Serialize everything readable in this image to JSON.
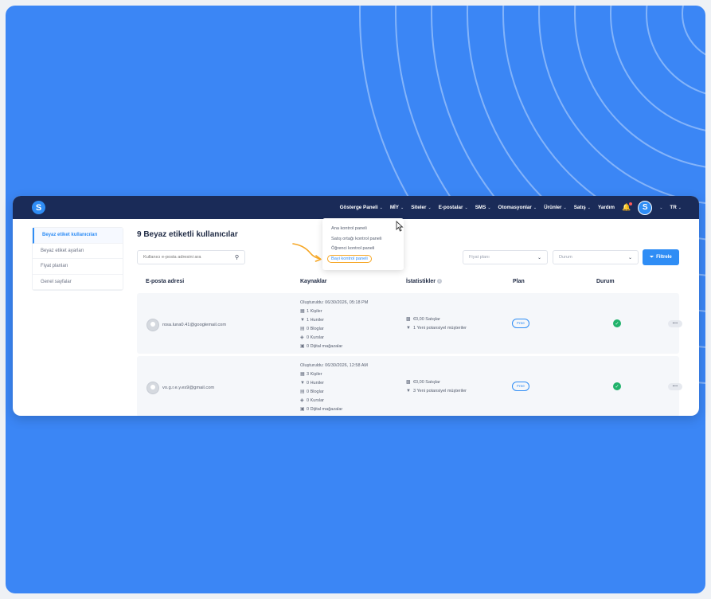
{
  "nav": {
    "items": [
      {
        "label": "Gösterge Paneli",
        "caret": "⌄"
      },
      {
        "label": "MİY",
        "caret": "⌄"
      },
      {
        "label": "Siteler",
        "caret": "⌄"
      },
      {
        "label": "E-postalar",
        "caret": "⌄"
      },
      {
        "label": "SMS",
        "caret": "⌄"
      },
      {
        "label": "Otomasyonlar",
        "caret": "⌄"
      },
      {
        "label": "Ürünler",
        "caret": "⌄"
      },
      {
        "label": "Satış",
        "caret": "⌄"
      },
      {
        "label": "Yardım",
        "caret": ""
      }
    ],
    "avatar_letter": "S",
    "language": "TR",
    "logo_letter": "S"
  },
  "sidebar": {
    "items": [
      {
        "label": "Beyaz etiket kullanıcıları",
        "active": true
      },
      {
        "label": "Beyaz etiket ayarları",
        "active": false
      },
      {
        "label": "Fiyat planları",
        "active": false
      },
      {
        "label": "Genel sayfalar",
        "active": false
      }
    ]
  },
  "main": {
    "title": "9 Beyaz etiketli kullanıcılar",
    "search_placeholder": "Kullanıcı e-posta adresini ara",
    "price_plan_placeholder": "Fiyat planı",
    "status_placeholder": "Durum",
    "filter_label": "Filtrele"
  },
  "table": {
    "headers": [
      "E-posta adresi",
      "Kaynaklar",
      "İstatistikler",
      "Plan",
      "Durum"
    ],
    "rows": [
      {
        "email": "rosa.luna0.41@googlemail.com",
        "created": "Oluşturuldu: 06/30/2026, 05:18 PM",
        "sources": [
          "1 Kişiler",
          "1 Huniler",
          "0 Bloglar",
          "0 Kurslar",
          "0 Dijital mağazalar"
        ],
        "stats": [
          "€0,00 Satışlar",
          "1 Yeni potansiyel müşteriler"
        ],
        "plan": "Free"
      },
      {
        "email": "vo.g.r.e.y.es9@gmail.com",
        "created": "Oluşturuldu: 06/30/2026, 12:58 AM",
        "sources": [
          "3 Kişiler",
          "0 Huniler",
          "0 Bloglar",
          "0 Kurslar",
          "0 Dijital mağazalar"
        ],
        "stats": [
          "€0,00 Satışlar",
          "3 Yeni potansiyel müşteriler"
        ],
        "plan": "Free"
      }
    ]
  },
  "dropdown": {
    "items": [
      {
        "label": "Ana kontrol paneli",
        "highlight": false
      },
      {
        "label": "Satış ortağı kontrol paneli",
        "highlight": false
      },
      {
        "label": "Öğrenci kontrol paneli",
        "highlight": false
      },
      {
        "label": "Bayi kontrol paneli",
        "highlight": true
      }
    ]
  },
  "colors": {
    "background_blue": "#3b86f5",
    "topbar": "#1a2b58",
    "accent": "#2f8df5",
    "success": "#21b26b",
    "highlight_border": "#f6a623"
  }
}
